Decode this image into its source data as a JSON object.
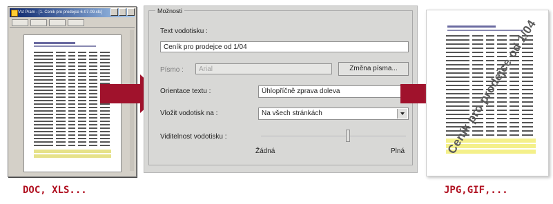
{
  "captions": {
    "left": "DOC, XLS...",
    "right": "JPG,GIF,..."
  },
  "colors": {
    "arrow": "#a0122c",
    "caption": "#b01020",
    "dialog_bg": "#d8d8d6",
    "highlight_row": "#f4f08a"
  },
  "source_window": {
    "title": "Vst Pram - [1. Cenik pro prodejce 6-07-09.xls]"
  },
  "dialog": {
    "group_title": "Možnosti",
    "watermark_text_label": "Text vodotisku :",
    "watermark_text_value": "Ceník pro prodejce od 1/04",
    "font_label": "Písmo :",
    "font_value": "Arial",
    "change_font_button": "Změna písma...",
    "orientation_label": "Orientace textu :",
    "orientation_value": "Úhlopříčně zprava doleva",
    "place_on_label": "Vložit vodotisk na :",
    "place_on_value": "Na všech stránkách",
    "visibility_label": "Viditelnost vodotisku :",
    "visibility_min_label": "Žádná",
    "visibility_max_label": "Plná",
    "visibility_level": 0.6
  },
  "output_page": {
    "watermark_text": "Ceník pro prodejce od 1/04"
  }
}
